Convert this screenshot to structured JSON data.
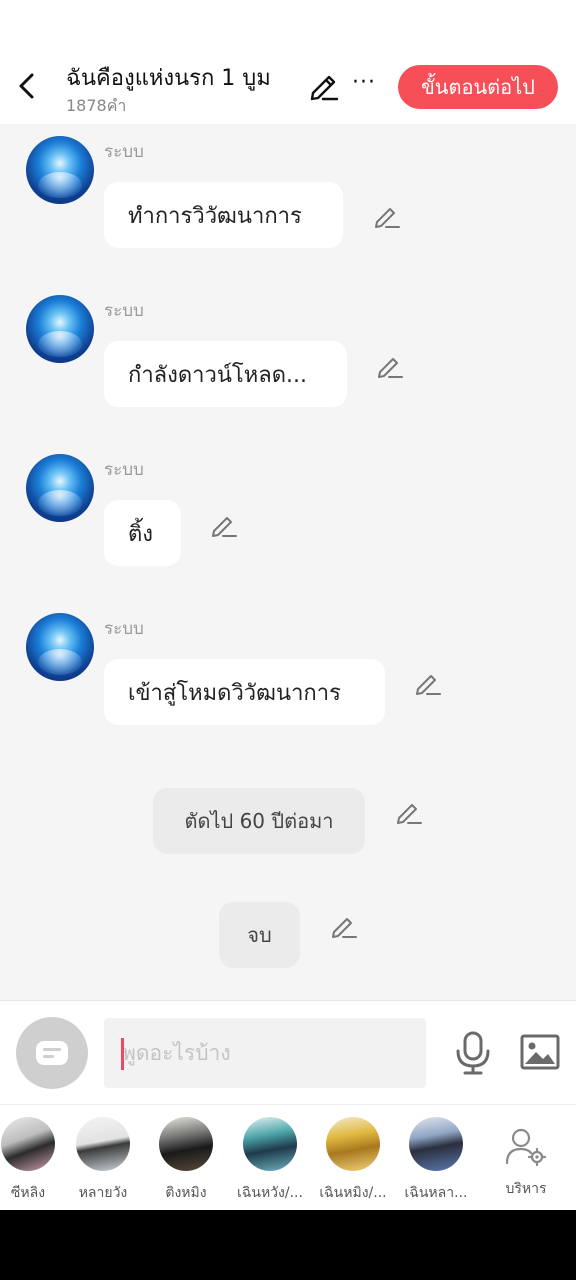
{
  "header": {
    "title": "ฉันคืองูแห่งนรก 1 บูม",
    "word_count": "1878คำ",
    "next_label": "ขั้นตอนต่อไป",
    "more_label": "···"
  },
  "colors": {
    "accent": "#f64f58",
    "background": "#f5f5f5",
    "caret": "#f0466a"
  },
  "messages": [
    {
      "sender": "ระบบ",
      "text": "ทำการวิวัฒนาการ"
    },
    {
      "sender": "ระบบ",
      "text": "กำลังดาวน์โหลด..."
    },
    {
      "sender": "ระบบ",
      "text": "ติ้ง"
    },
    {
      "sender": "ระบบ",
      "text": "เข้าสู่โหมดวิวัฒนาการ"
    }
  ],
  "narrations": [
    {
      "text": "ตัดไป 60 ปีต่อมา"
    },
    {
      "text": "จบ"
    }
  ],
  "input": {
    "placeholder": "พูดอะไรบ้าง",
    "value": ""
  },
  "characters": [
    {
      "name": "ซีหลิง"
    },
    {
      "name": "หลายวัง"
    },
    {
      "name": "ติงหมิง"
    },
    {
      "name": "เฉินหวัง/..."
    },
    {
      "name": "เฉินหมิง/..."
    },
    {
      "name": "เฉินหลา..."
    }
  ],
  "manage_label": "บริหาร"
}
